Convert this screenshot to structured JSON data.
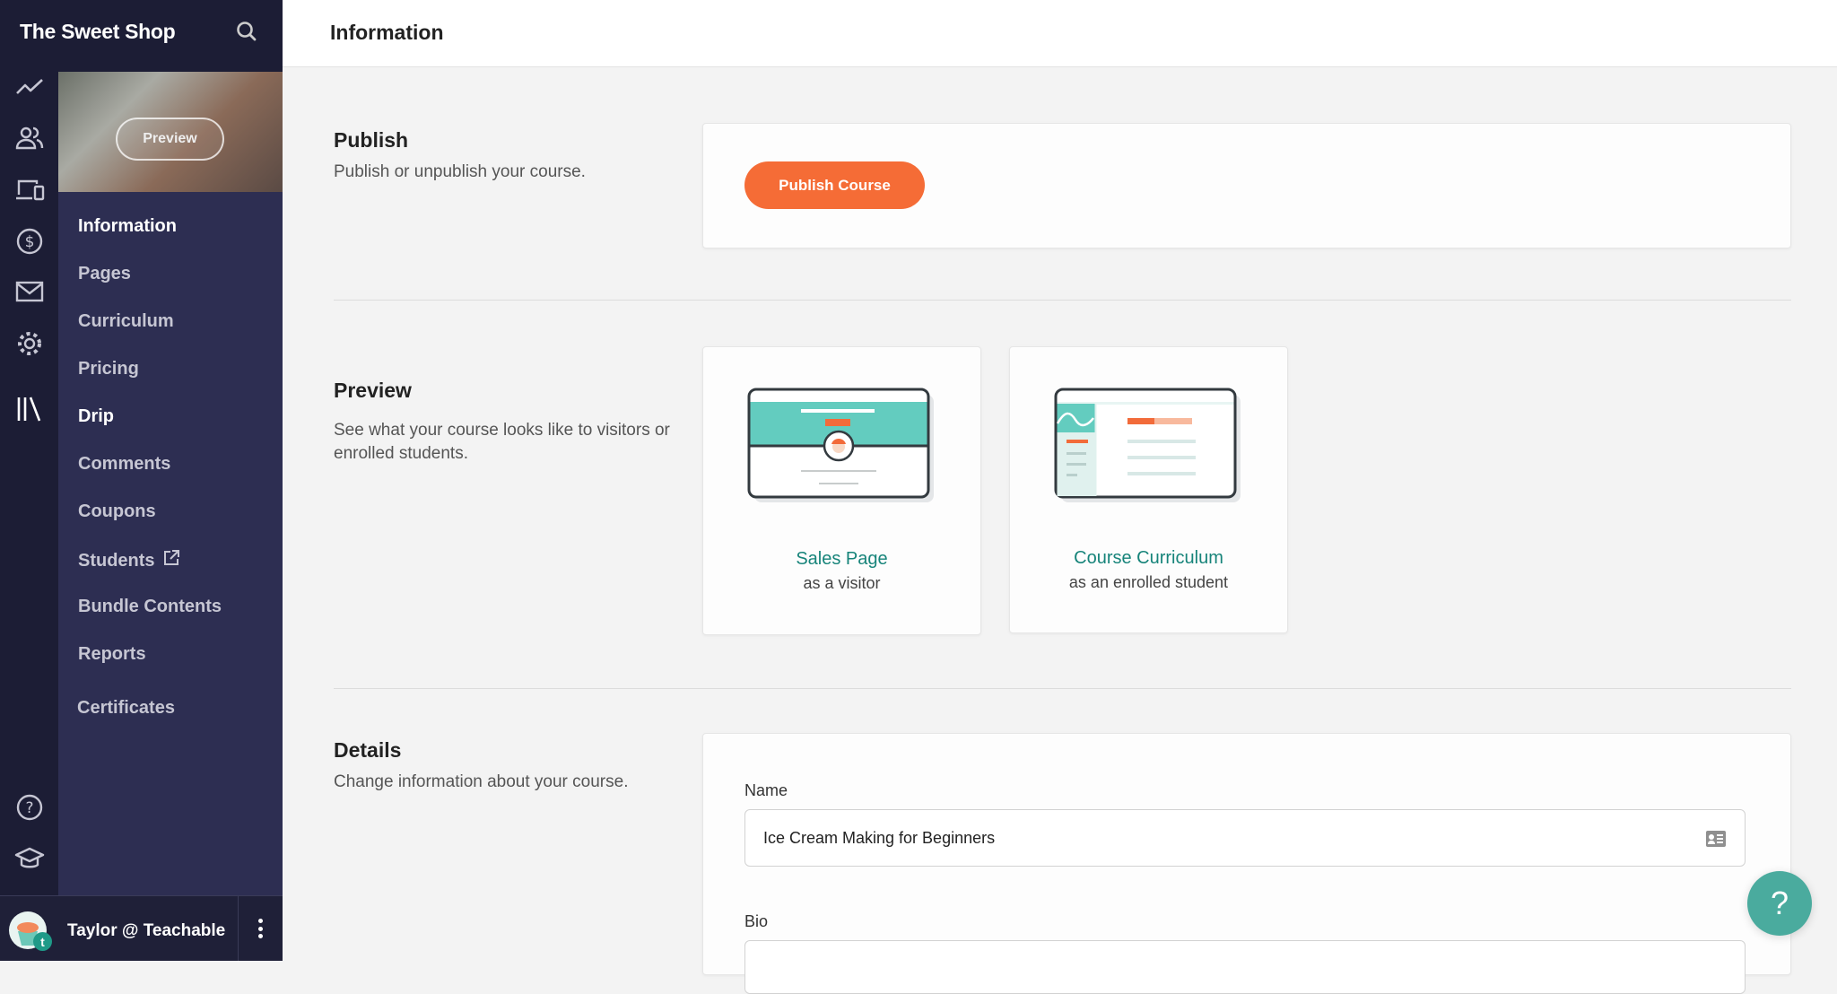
{
  "sidebar": {
    "brand": "The Sweet Shop",
    "cover_preview_label": "Preview",
    "nav": [
      {
        "label": "Information",
        "active": true
      },
      {
        "label": "Pages"
      },
      {
        "label": "Curriculum"
      },
      {
        "label": "Pricing"
      },
      {
        "label": "Drip"
      },
      {
        "label": "Comments"
      },
      {
        "label": "Coupons"
      },
      {
        "label": "Students",
        "icon": "external-link-icon"
      },
      {
        "label": "Bundle Contents"
      },
      {
        "label": "Reports"
      },
      {
        "label": "Certificates"
      }
    ],
    "rail_icons": [
      "analytics-icon",
      "users-icon",
      "devices-icon",
      "dollar-icon",
      "mail-icon",
      "gear-icon",
      "library-icon",
      "help-icon",
      "graduation-cap-icon"
    ],
    "user": {
      "name": "Taylor @ Teachable",
      "avatar_badge": "t"
    }
  },
  "header": {
    "title": "Information"
  },
  "publish": {
    "heading": "Publish",
    "description": "Publish or unpublish your course.",
    "button": "Publish Course",
    "button_color": "#f56c36"
  },
  "preview": {
    "heading": "Preview",
    "description": "See what your course looks like to visitors or enrolled students.",
    "cards": [
      {
        "title": "Sales Page",
        "subtitle": "as a visitor"
      },
      {
        "title": "Course Curriculum",
        "subtitle": "as an enrolled student"
      }
    ]
  },
  "details": {
    "heading": "Details",
    "description": "Change information about your course.",
    "name_label": "Name",
    "name_value": "Ice Cream Making for Beginners",
    "bio_label": "Bio",
    "bio_value": ""
  },
  "help_button": "?"
}
